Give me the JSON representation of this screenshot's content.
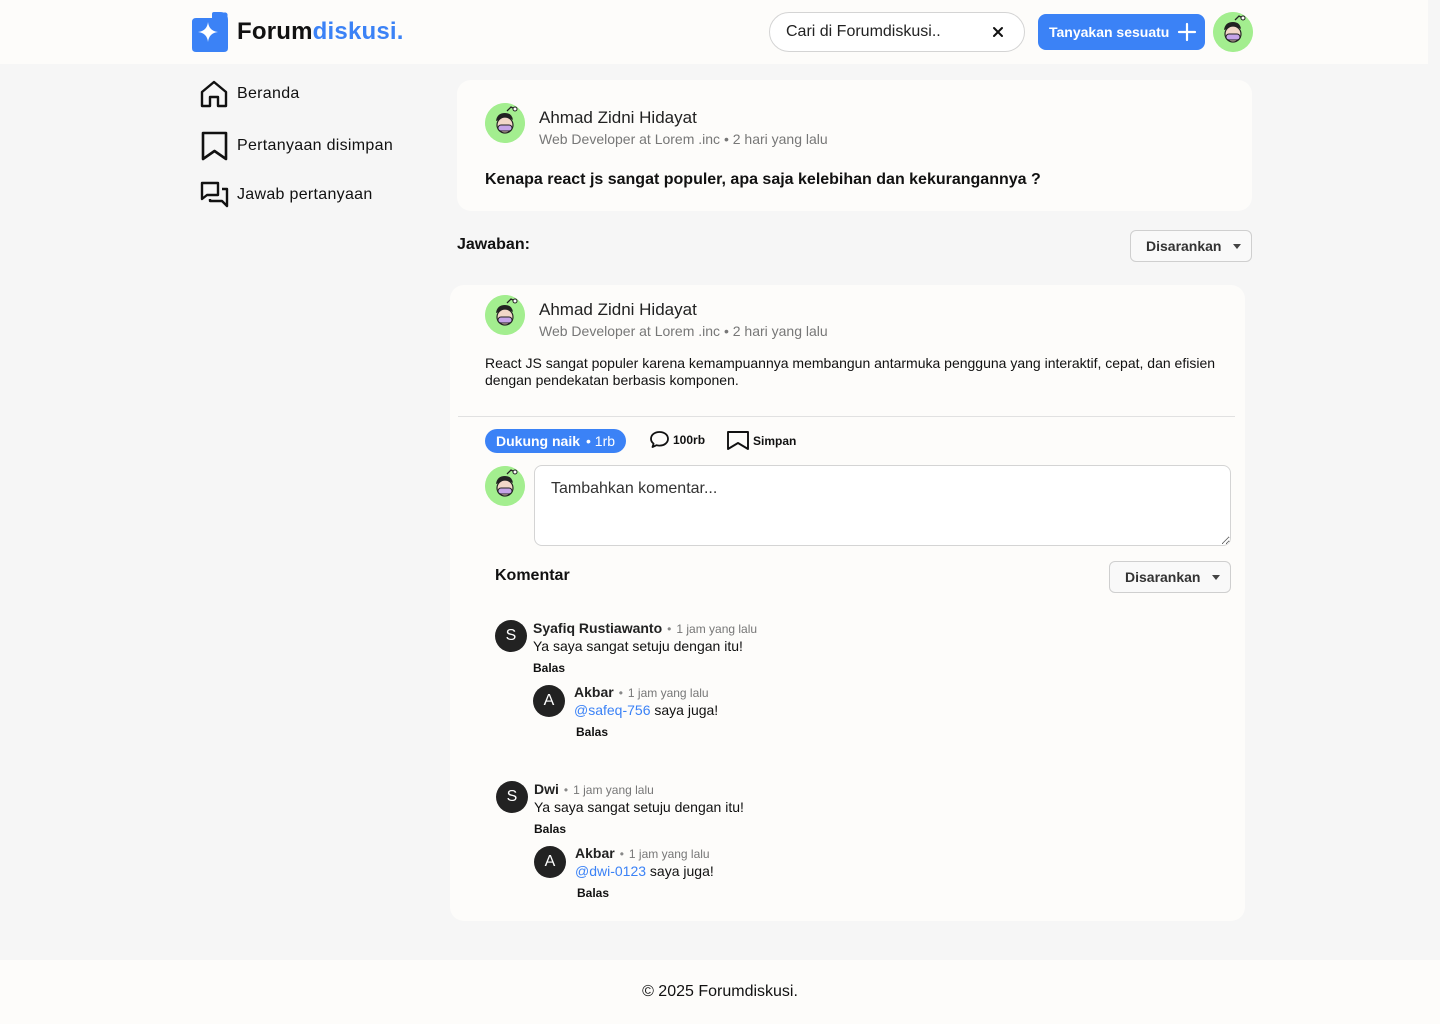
{
  "header": {
    "logo_text_bold": "Forum",
    "logo_text_accent": "diskusi.",
    "search_placeholder": "Cari di Forumdiskusi..",
    "ask_button": "Tanyakan sesuatu"
  },
  "sidebar": {
    "items": [
      {
        "label": "Beranda",
        "icon": "home-icon"
      },
      {
        "label": "Pertanyaan disimpan",
        "icon": "bookmark-icon"
      },
      {
        "label": "Jawab pertanyaan",
        "icon": "chat-icon"
      }
    ]
  },
  "question": {
    "author": "Ahmad Zidni Hidayat",
    "meta": "Web Developer at Lorem .inc • 2 hari yang lalu",
    "title": "Kenapa react js sangat populer, apa saja kelebihan dan kekurangannya ?"
  },
  "answers_section": {
    "label": "Jawaban:",
    "sort": "Disarankan"
  },
  "answer": {
    "author": "Ahmad Zidni Hidayat",
    "meta": "Web Developer at Lorem .inc • 2 hari yang lalu",
    "body": "React JS sangat populer karena kemampuannya membangun antarmuka pengguna yang interaktif, cepat, dan efisien dengan pendekatan berbasis komponen.",
    "vote_label": "Dukung naik",
    "vote_count": "• 1rb",
    "comment_count": "100rb",
    "save_label": "Simpan",
    "comment_placeholder": "Tambahkan komentar...",
    "comments_label": "Komentar",
    "comments_sort": "Disarankan"
  },
  "comments": [
    {
      "initial": "S",
      "name": "Syafiq Rustiawanto",
      "dot": "•",
      "time": "1 jam yang lalu",
      "text": "Ya saya sangat setuju dengan itu!",
      "reply_label": "Balas",
      "reply": {
        "initial": "A",
        "name": "Akbar",
        "dot": "•",
        "time": "1 jam yang lalu",
        "mention": "@safeq-756",
        "text": " saya juga!",
        "reply_label": "Balas"
      }
    },
    {
      "initial": "S",
      "name": "Dwi",
      "dot": "•",
      "time": "1 jam yang lalu",
      "text": "Ya saya sangat setuju dengan itu!",
      "reply_label": "Balas",
      "reply": {
        "initial": "A",
        "name": "Akbar",
        "dot": "•",
        "time": "1 jam yang lalu",
        "mention": "@dwi-0123",
        "text": " saya juga!",
        "reply_label": "Balas"
      }
    }
  ],
  "footer": {
    "text": "© 2025 Forumdiskusi."
  },
  "colors": {
    "accent": "#3b82f6",
    "avatar_bg": "#a3ee8f",
    "page_bg": "#f6f6f6",
    "card_bg": "#fdfcfa"
  }
}
